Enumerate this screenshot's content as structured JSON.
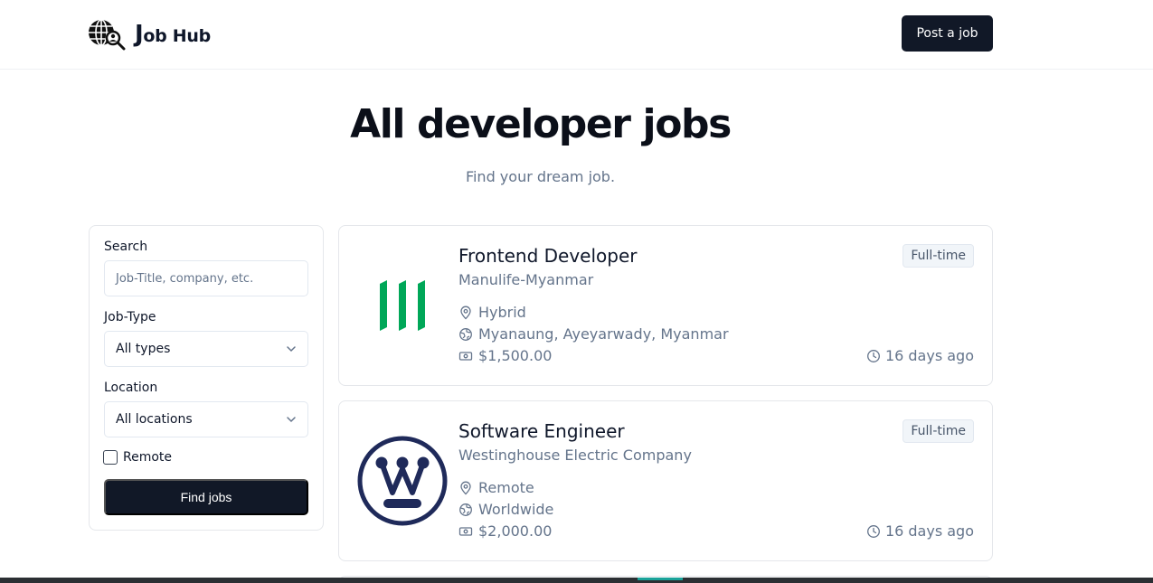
{
  "header": {
    "brand_initial": "J",
    "brand_rest": "ob Hub",
    "logo_icon": "globe-search-icon",
    "post_job_label": "Post a job"
  },
  "hero": {
    "title": "All developer jobs",
    "subtitle": "Find your dream job."
  },
  "filters": {
    "search_label": "Search",
    "search_placeholder": "Job-Title, company, etc.",
    "job_type_label": "Job-Type",
    "job_type_value": "All types",
    "location_label": "Location",
    "location_value": "All locations",
    "remote_label": "Remote",
    "remote_checked": false,
    "find_label": "Find jobs"
  },
  "jobs": [
    {
      "title": "Frontend Developer",
      "company": "Manulife-Myanmar",
      "type": "Full-time",
      "location_type": "Hybrid",
      "location": "Myanaung, Ayeyarwady, Myanmar",
      "salary": "$1,500.00",
      "posted": "16 days ago",
      "logo": "manulife-logo",
      "logo_color": "#00a758"
    },
    {
      "title": "Software Engineer",
      "company": "Westinghouse Electric Company",
      "type": "Full-time",
      "location_type": "Remote",
      "location": "Worldwide",
      "salary": "$2,000.00",
      "posted": "16 days ago",
      "logo": "westinghouse-logo",
      "logo_color": "#1f2a5a"
    }
  ],
  "colors": {
    "primary_button": "#111827",
    "muted_text": "#64748b",
    "border": "#e5e7eb"
  }
}
